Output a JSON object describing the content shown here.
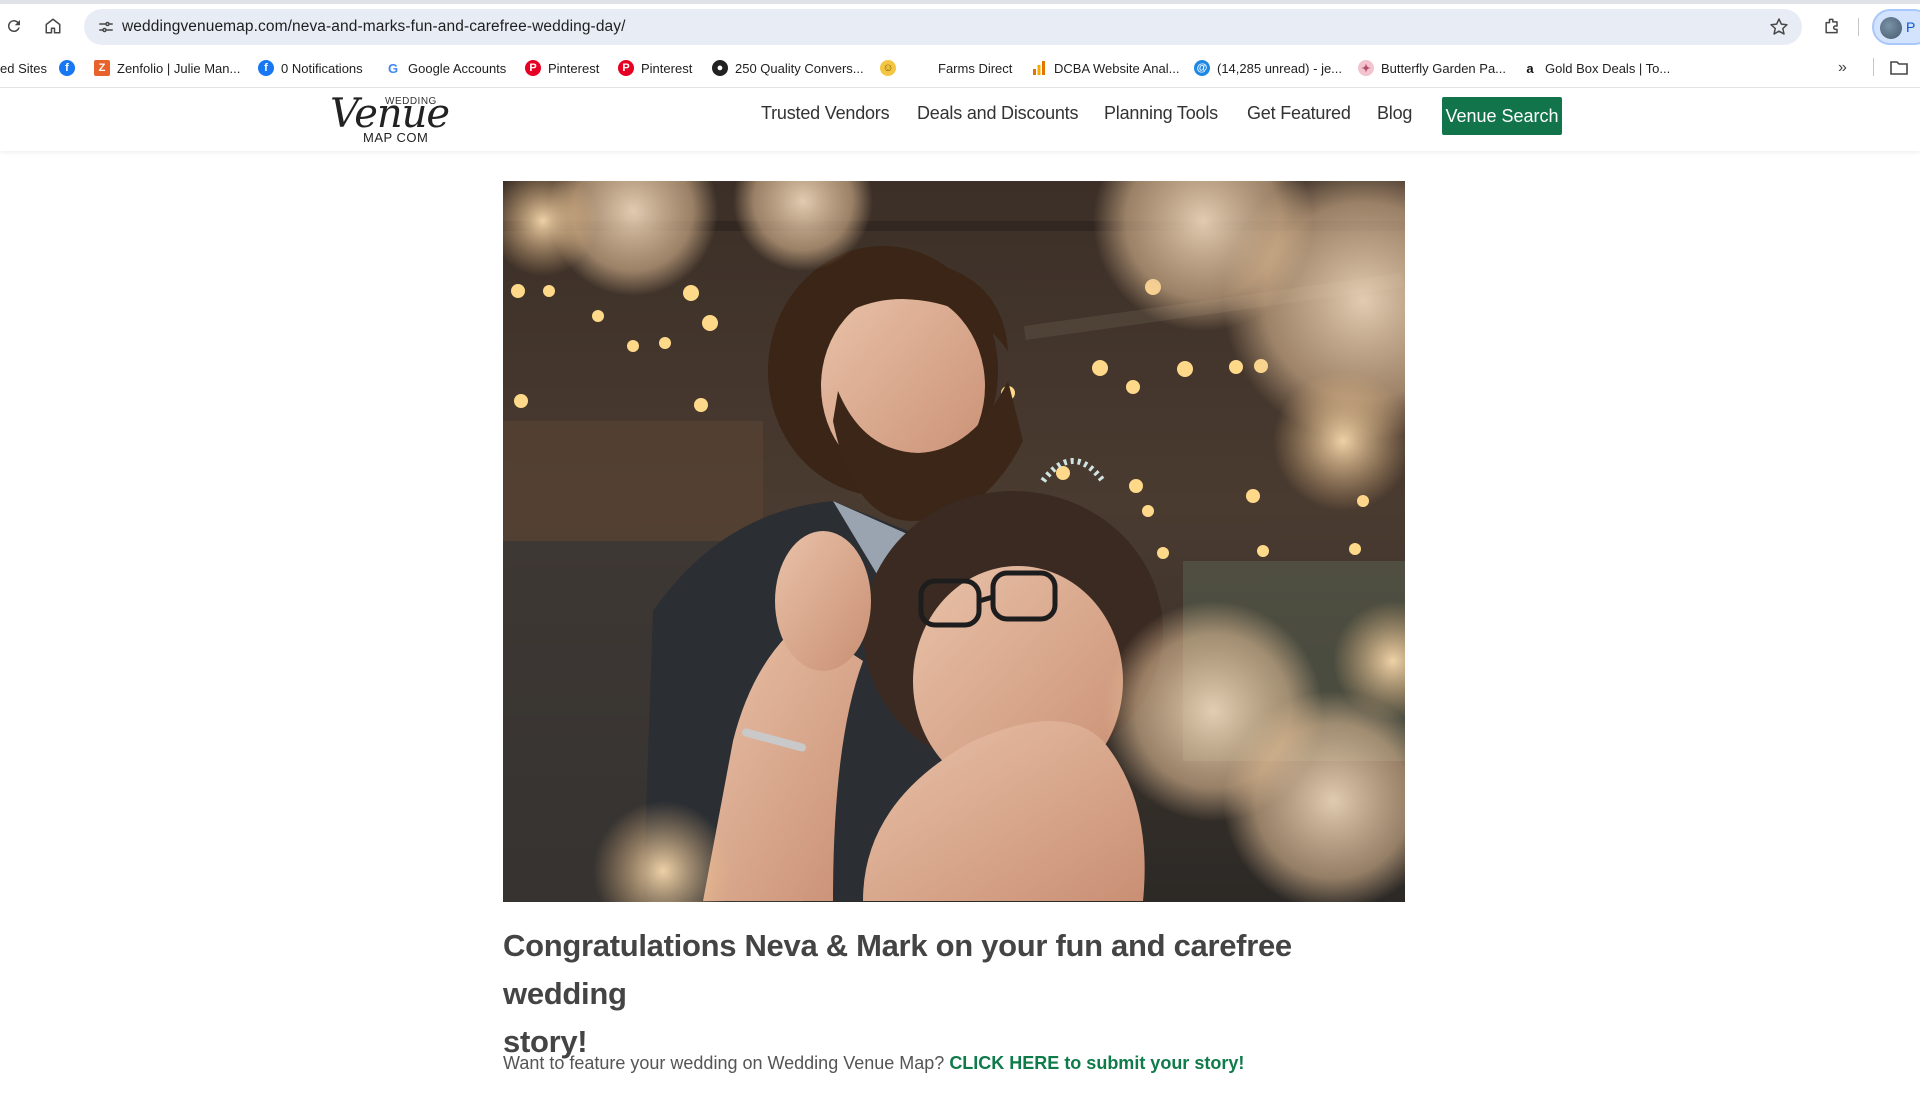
{
  "browser": {
    "url": "weddingvenuemap.com/neva-and-marks-fun-and-carefree-wedding-day/",
    "profile_letter": "P"
  },
  "bookmarks": [
    {
      "label": "ed Sites",
      "icon": "none"
    },
    {
      "label": "",
      "icon": "facebook-icon"
    },
    {
      "label": "Zenfolio | Julie Man...",
      "icon": "zenfolio-icon"
    },
    {
      "label": "0 Notifications",
      "icon": "facebook-icon"
    },
    {
      "label": "Google Accounts",
      "icon": "google-icon"
    },
    {
      "label": "Pinterest",
      "icon": "pinterest-icon"
    },
    {
      "label": "Pinterest",
      "icon": "pinterest-icon"
    },
    {
      "label": "250 Quality Convers...",
      "icon": "globe-icon"
    },
    {
      "label": "",
      "icon": "emoji-icon"
    },
    {
      "label": "Farms Direct",
      "icon": "none"
    },
    {
      "label": "DCBA Website Anal...",
      "icon": "analytics-icon"
    },
    {
      "label": "(14,285 unread) - je...",
      "icon": "mail-icon"
    },
    {
      "label": "Butterfly Garden Pa...",
      "icon": "butterfly-icon"
    },
    {
      "label": "Gold Box Deals | To...",
      "icon": "amazon-icon"
    }
  ],
  "site": {
    "logo": {
      "wedding": "WEDDING",
      "venue": "Venue",
      "map": "MAP COM"
    },
    "nav": [
      "Trusted Vendors",
      "Deals and Discounts",
      "Planning Tools",
      "Get Featured",
      "Blog"
    ],
    "cta": "Venue Search"
  },
  "post": {
    "title_line1": "Congratulations Neva & Mark on your fun and carefree wedding",
    "title_line2": "story!",
    "cta_text": "Want to feature your wedding on Wedding Venue Map?",
    "cta_link": "CLICK HERE to submit your story!"
  },
  "colors": {
    "brand_green": "#11744a",
    "link_green": "#0f7a4a",
    "omnibox_bg": "#e8edf5"
  }
}
